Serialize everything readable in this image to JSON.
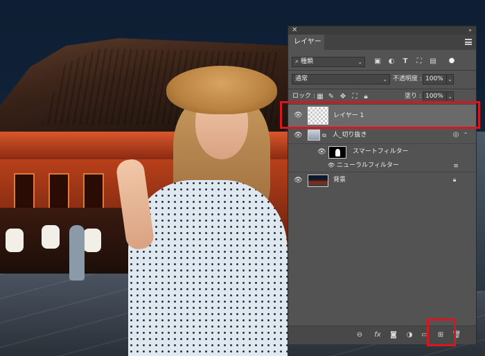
{
  "panel": {
    "tab_label": "レイヤー",
    "close_glyph": "✕",
    "collapse_glyph": "»",
    "filter": {
      "kind_value": "種類",
      "icons": [
        "image-filter-icon",
        "adjustment-filter-icon",
        "type-filter-icon",
        "shape-filter-icon",
        "smart-object-filter-icon",
        "filter-toggle-icon"
      ]
    },
    "blend": {
      "mode_value": "通常",
      "opacity_label": "不透明度 :",
      "opacity_value": "100%"
    },
    "lock": {
      "label": "ロック :",
      "fill_label": "塗り :",
      "fill_value": "100%"
    },
    "layers": [
      {
        "name": "レイヤー 1",
        "thumbnail": "transparent",
        "selected": true
      },
      {
        "name": "人_切り抜き",
        "thumbnail": "person-cutout",
        "smart_object": true
      },
      {
        "name": "スマートフィルター",
        "thumbnail": "mask-white-figure",
        "indent": 1
      },
      {
        "name": "ニューラルフィルター",
        "indent": 2
      },
      {
        "name": "背景",
        "thumbnail": "night-street",
        "locked": true
      }
    ],
    "bottom_icons": [
      "link-layers-icon",
      "fx-icon",
      "add-mask-icon",
      "adjustment-layer-icon",
      "new-group-icon",
      "new-layer-icon",
      "trash-icon"
    ],
    "fx_text": "fx",
    "highlight_color": "#d9161c"
  }
}
